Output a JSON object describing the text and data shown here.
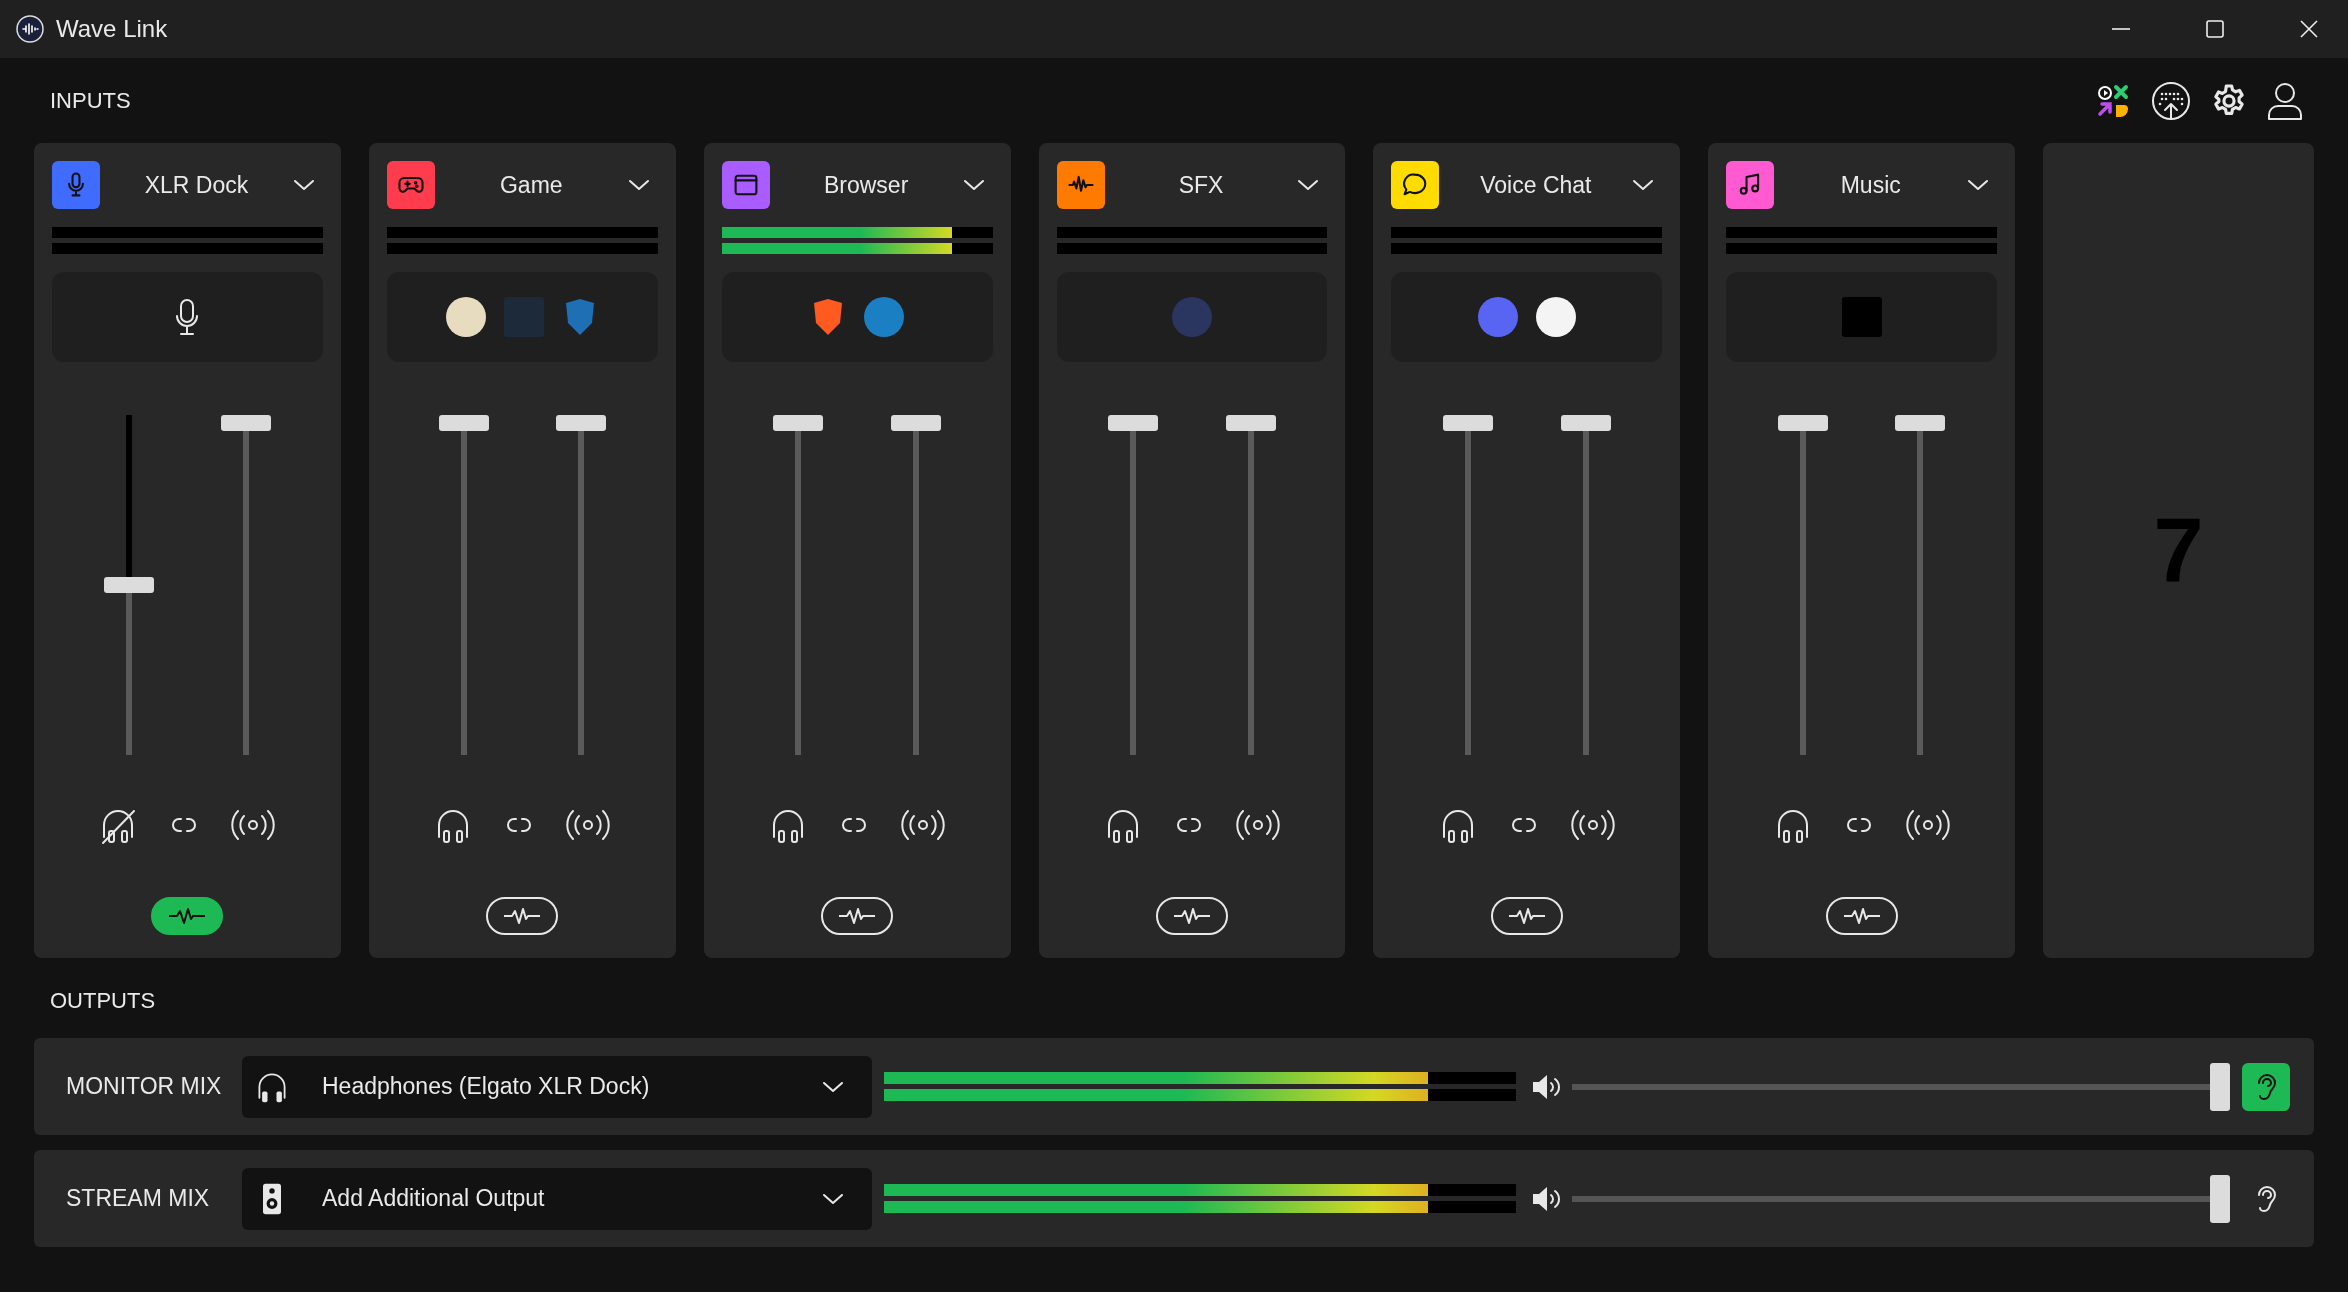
{
  "window": {
    "title": "Wave Link"
  },
  "inputs": {
    "label": "INPUTS",
    "channels": [
      {
        "name": "XLR Dock",
        "kind": "mic",
        "color": "#3f6bff",
        "meter": {
          "level": 0
        },
        "apps": [
          {
            "kind": "mic"
          }
        ],
        "monitor_slider": {
          "level": 0.5
        },
        "stream_slider": {
          "level": 1
        },
        "monitor_muted": true,
        "effects_on": true
      },
      {
        "name": "Game",
        "kind": "gamepad",
        "color": "#ff3b4e",
        "meter": {
          "level": 0
        },
        "apps": [
          {
            "kind": "disc",
            "color": "#e8dcc0"
          },
          {
            "kind": "tile",
            "color": "#1c2a3a"
          },
          {
            "kind": "shield",
            "color": "#1f6fb5"
          }
        ],
        "monitor_slider": {
          "level": 1
        },
        "stream_slider": {
          "level": 1
        },
        "monitor_muted": false,
        "effects_on": false
      },
      {
        "name": "Browser",
        "kind": "window",
        "color": "#a95cff",
        "meter": {
          "level": 0.85
        },
        "apps": [
          {
            "kind": "shield",
            "color": "#ff5a1f"
          },
          {
            "kind": "disc",
            "color": "#1b7fc4"
          }
        ],
        "monitor_slider": {
          "level": 1
        },
        "stream_slider": {
          "level": 1
        },
        "monitor_muted": false,
        "effects_on": false
      },
      {
        "name": "SFX",
        "kind": "wave",
        "color": "#ff7a00",
        "meter": {
          "level": 0
        },
        "apps": [
          {
            "kind": "disc",
            "color": "#2a3560"
          }
        ],
        "monitor_slider": {
          "level": 1
        },
        "stream_slider": {
          "level": 1
        },
        "monitor_muted": false,
        "effects_on": false
      },
      {
        "name": "Voice Chat",
        "kind": "chat",
        "color": "#ffdc00",
        "meter": {
          "level": 0
        },
        "apps": [
          {
            "kind": "disc",
            "color": "#5865f2"
          },
          {
            "kind": "disc",
            "color": "#f4f4f4"
          }
        ],
        "monitor_slider": {
          "level": 1
        },
        "stream_slider": {
          "level": 1
        },
        "monitor_muted": false,
        "effects_on": false
      },
      {
        "name": "Music",
        "kind": "note",
        "color": "#ff5ad2",
        "meter": {
          "level": 0
        },
        "apps": [
          {
            "kind": "tile",
            "color": "#000000"
          }
        ],
        "monitor_slider": {
          "level": 1
        },
        "stream_slider": {
          "level": 1
        },
        "monitor_muted": false,
        "effects_on": false
      }
    ],
    "empty_slot": {
      "label": "7"
    }
  },
  "outputs": {
    "label": "OUTPUTS",
    "mixes": [
      {
        "name": "MONITOR MIX",
        "kind": "headphones",
        "device": "Headphones (Elgato XLR Dock)",
        "meter": {
          "level": 0.86
        },
        "volume": {
          "level": 1
        },
        "listening": true
      },
      {
        "name": "STREAM MIX",
        "kind": "speaker",
        "device": "Add Additional Output",
        "meter": {
          "level": 0.86
        },
        "volume": {
          "level": 1
        },
        "listening": false
      }
    ]
  }
}
